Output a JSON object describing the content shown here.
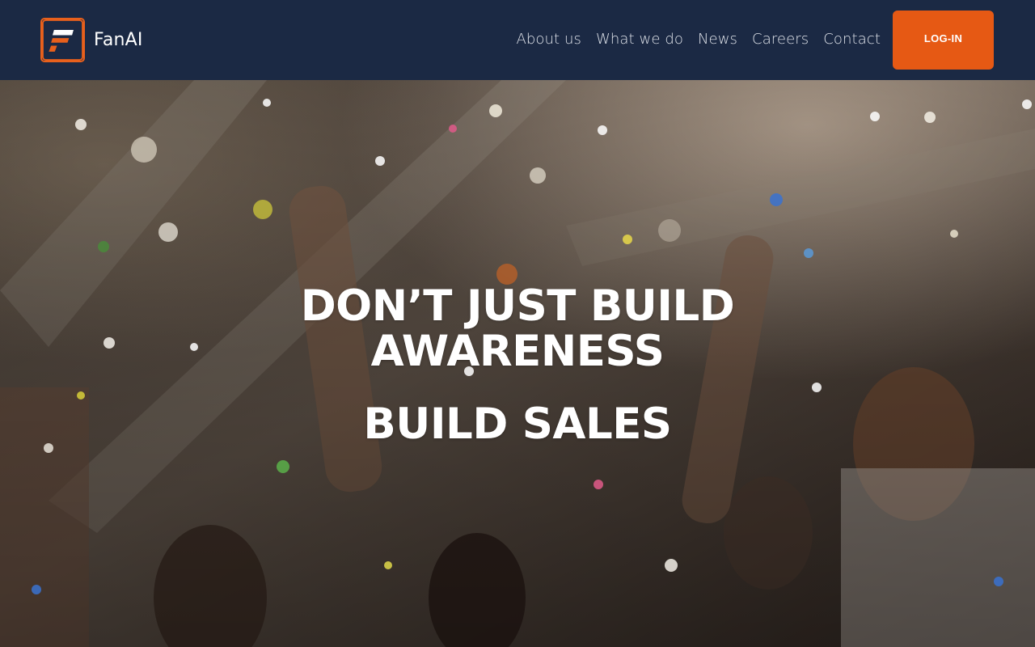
{
  "header": {
    "brand": "FanAI",
    "nav": [
      {
        "label": "About us"
      },
      {
        "label": "What we do"
      },
      {
        "label": "News"
      },
      {
        "label": "Careers"
      },
      {
        "label": "Contact"
      }
    ],
    "login_label": "LOG-IN"
  },
  "hero": {
    "headline_line1": "DON’T JUST BUILD",
    "headline_line2": "AWARENESS",
    "subheadline": "BUILD SALES"
  },
  "colors": {
    "header_bg": "#1b2944",
    "accent": "#e65914",
    "text": "#ffffff"
  },
  "icons": [
    "fanai-logo-icon"
  ]
}
